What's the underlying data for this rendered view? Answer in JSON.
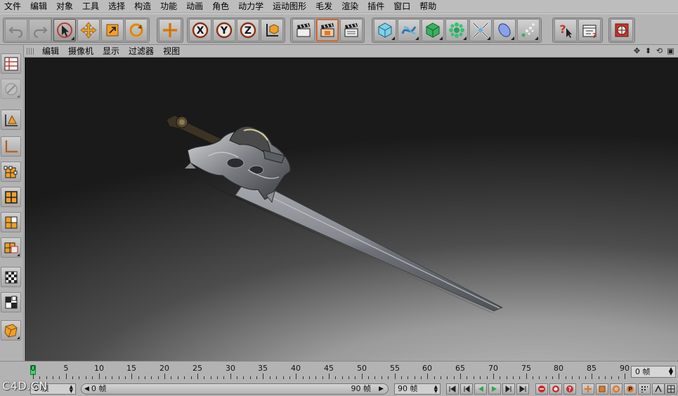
{
  "menu": [
    "文件",
    "编辑",
    "对象",
    "工具",
    "选择",
    "构造",
    "功能",
    "动画",
    "角色",
    "动力学",
    "运动图形",
    "毛发",
    "渲染",
    "插件",
    "窗口",
    "帮助"
  ],
  "toolbar": {
    "icons": [
      "undo-icon",
      "redo-icon",
      "select-arrow-icon",
      "move-icon",
      "scale-icon",
      "rotate-icon",
      "world-axis-icon",
      "x-axis-icon",
      "y-axis-icon",
      "z-axis-icon",
      "coordinate-system-icon",
      "render-view-icon",
      "render-picture-viewer-icon",
      "render-settings-icon",
      "cube-icon",
      "spline-icon",
      "nurbs-icon",
      "array-icon",
      "deformer-icon",
      "scene-object-icon",
      "particle-icon",
      "help-icon",
      "timeline-icon",
      "browser-icon"
    ],
    "axes": [
      "X",
      "Y",
      "Z"
    ]
  },
  "viewport_menu": [
    "编辑",
    "摄像机",
    "显示",
    "过滤器",
    "视图"
  ],
  "viewport_nav": [
    "move-view-icon",
    "zoom-view-icon",
    "rotate-view-icon",
    "maximize-view-icon"
  ],
  "timeline": {
    "ticks": [
      "0",
      "5",
      "10",
      "15",
      "20",
      "25",
      "30",
      "35",
      "40",
      "45",
      "50",
      "55",
      "60",
      "65",
      "70",
      "75",
      "80",
      "85",
      "90"
    ],
    "current_frame": "0 帧"
  },
  "bottom": {
    "start_frame": "0 帧",
    "range_left": "0 帧",
    "range_right": "90 帧",
    "end_frame": "90 帧"
  },
  "colors": {
    "accent_orange": "#e07a2a",
    "timeline_cursor": "#42d66a",
    "record_red": "#cc2b2b"
  },
  "watermark": "C4D.CN"
}
